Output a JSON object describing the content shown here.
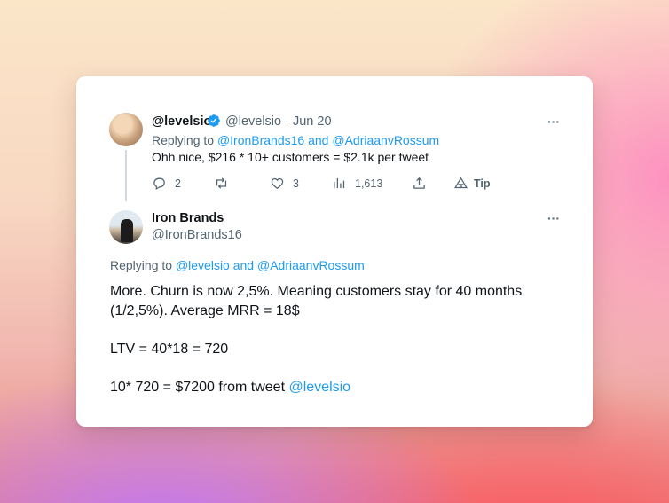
{
  "tweet1": {
    "name": "@levelsio",
    "handle": "@levelsio",
    "date": "· Jun 20",
    "reply_prefix": "Replying to ",
    "reply_mention1": "@IronBrands16",
    "reply_and": " and ",
    "reply_mention2": "@AdriaanvRossum",
    "text": "Ohh nice, $216 * 10+ customers = $2.1k per tweet",
    "more": "···",
    "actions": {
      "replies": "2",
      "retweets": "",
      "likes": "3",
      "views": "1,613",
      "tip": "Tip"
    }
  },
  "tweet2": {
    "name": "Iron Brands",
    "handle": "@IronBrands16",
    "more": "···",
    "reply_prefix": "Replying to ",
    "reply_mention1": "@levelsio",
    "reply_and": " and ",
    "reply_mention2": "@AdriaanvRossum",
    "line1": "More. Churn is now 2,5%. Meaning customers stay for 40 months",
    "line2": "(1/2,5%). Average MRR = 18$",
    "line3": "LTV = 40*18 = 720",
    "line4_text": "10* 720 = $7200 from tweet ",
    "line4_mention": "@levelsio"
  },
  "icons": {
    "verified": "verified-badge-icon",
    "reply": "reply-icon",
    "retweet": "retweet-icon",
    "like": "heart-icon",
    "views": "views-icon",
    "share": "share-icon",
    "tip": "tip-icon"
  },
  "colors": {
    "link": "#1d9bf0",
    "text": "#0f1419",
    "muted": "#536471"
  }
}
